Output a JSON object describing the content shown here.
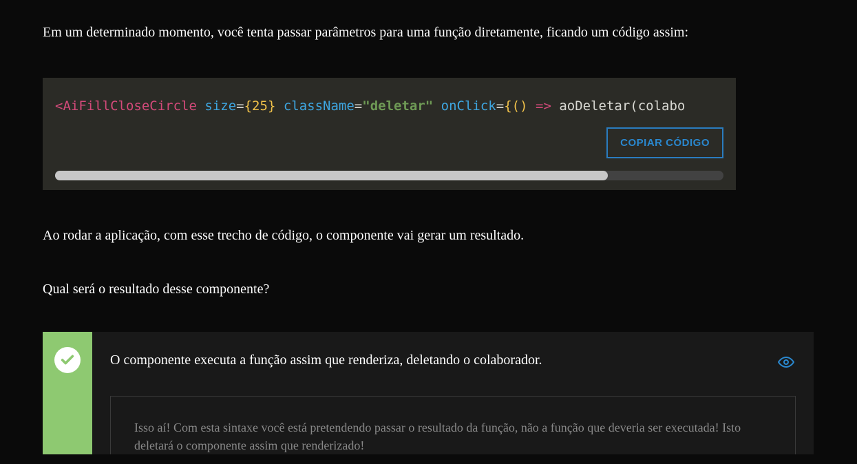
{
  "intro": "Em um determinado momento, você tenta passar parâmetros para uma função diretamente, ficando um código assim:",
  "code": {
    "lt": "<",
    "component": "AiFillCloseCircle",
    "attr_size": "size",
    "eq": "=",
    "brace_open": "{",
    "size_val": "25",
    "brace_close": "}",
    "attr_class": "className",
    "class_val": "\"deletar\"",
    "attr_onclick": "onClick",
    "paren_open": "(",
    "paren_close": ")",
    "arrow": "=>",
    "call": "aoDeletar(colabo"
  },
  "copy_label": "COPIAR CÓDIGO",
  "para1": "Ao rodar a aplicação, com esse trecho de código, o componente vai gerar um resultado.",
  "para2": "Qual será o resultado desse componente?",
  "answer": {
    "title": "O componente executa a função assim que renderiza, deletando o colaborador.",
    "explain": "Isso aí! Com esta sintaxe você está pretendendo passar o resultado da função, não a função que deveria ser executada! Isto deletará o componente assim que renderizado!"
  }
}
